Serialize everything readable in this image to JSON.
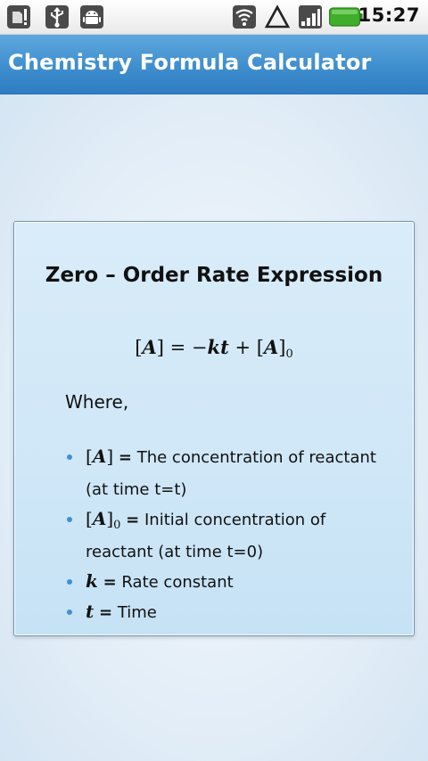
{
  "status_bar": {
    "time": "15:27",
    "icons": [
      "sd-card-alert-icon",
      "usb-icon",
      "android-debug-icon",
      "wifi-icon",
      "triangle-icon",
      "signal-icon",
      "battery-icon"
    ]
  },
  "app": {
    "title": "Chemistry Formula Calculator"
  },
  "card": {
    "title": "Zero – Order Rate Expression",
    "formula": {
      "lhs_open": "[",
      "lhs_var": "A",
      "lhs_close": "]",
      "equals": " = −",
      "k": "k",
      "t": "t",
      "plus": " + [",
      "rhs_var": "A",
      "rhs_close": "]",
      "subscript": "0"
    },
    "where_label": "Where,",
    "definitions": [
      {
        "symbol": "A",
        "subscript": "",
        "description": "The concentration of reactant (at time t=t)"
      },
      {
        "symbol": "A",
        "subscript": "0",
        "description": "Initial concentration of reactant (at time t=0)"
      },
      {
        "symbol": "k",
        "subscript": "",
        "description": "Rate constant"
      },
      {
        "symbol": "t",
        "subscript": "",
        "description": "Time"
      }
    ]
  },
  "colors": {
    "title_bar": "#3f8ece",
    "card_background": "#cfe7f7",
    "card_border": "#6f93b8",
    "bullet": "#3f91d3",
    "battery_green": "#3fae2a"
  }
}
